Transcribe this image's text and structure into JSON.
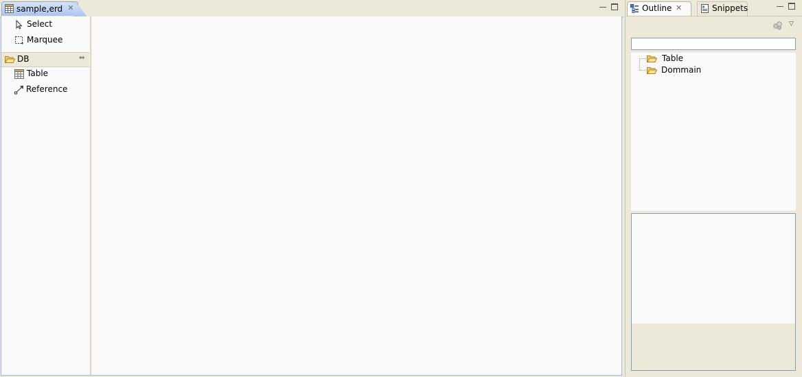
{
  "editor": {
    "tab_label": "sample,erd",
    "tab_close": "✕"
  },
  "palette": {
    "tools": [
      {
        "label": "Select",
        "icon": "arrow-pointer-icon"
      },
      {
        "label": "Marquee",
        "icon": "marquee-icon"
      }
    ],
    "drawer": {
      "label": "DB",
      "icon": "folder-open-icon",
      "pin": "⇔"
    },
    "drawer_items": [
      {
        "label": "Table",
        "icon": "table-icon"
      },
      {
        "label": "Reference",
        "icon": "connection-icon"
      }
    ]
  },
  "view": {
    "tabs": [
      {
        "label": "Outline",
        "icon": "outline-icon",
        "close": "✕"
      },
      {
        "label": "Snippets",
        "icon": "snippets-icon"
      }
    ],
    "menu_glyph": "▽",
    "filter": {
      "value": "",
      "placeholder": ""
    },
    "tree": [
      {
        "label": "Table",
        "icon": "folder-open-icon"
      },
      {
        "label": "Dommain",
        "icon": "folder-open-icon"
      }
    ]
  },
  "colors": {
    "chrome_bg": "#ece9d8",
    "active_tab": "#a9c4ef",
    "canvas_bg": "#fafafa",
    "folder": "#e8b54a"
  }
}
